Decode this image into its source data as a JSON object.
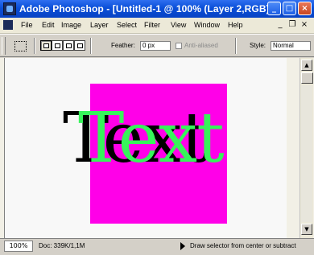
{
  "window": {
    "title": "Adobe Photoshop - [Untitled-1 @ 100% (Layer 2,RGB)]",
    "minimize_glyph": "_",
    "maximize_glyph": "□",
    "close_glyph": "×"
  },
  "menu": {
    "items": [
      "File",
      "Edit",
      "Image",
      "Layer",
      "Select",
      "Filter",
      "View",
      "Window",
      "Help"
    ],
    "mdi_minimize": "_",
    "mdi_restore": "❐",
    "mdi_close": "×"
  },
  "options": {
    "feather_label": "Feather:",
    "feather_value": "0 px",
    "antialiased_label": "Anti-aliased",
    "style_label": "Style:",
    "style_value": "Normal"
  },
  "canvas": {
    "text_content": "Text",
    "layer_color": "#ff00e8",
    "text_color": "#37f45a"
  },
  "status": {
    "zoom": "100%",
    "doc_size": "Doc: 339K/1,1M",
    "hint": "Draw selector from center or subtract"
  }
}
